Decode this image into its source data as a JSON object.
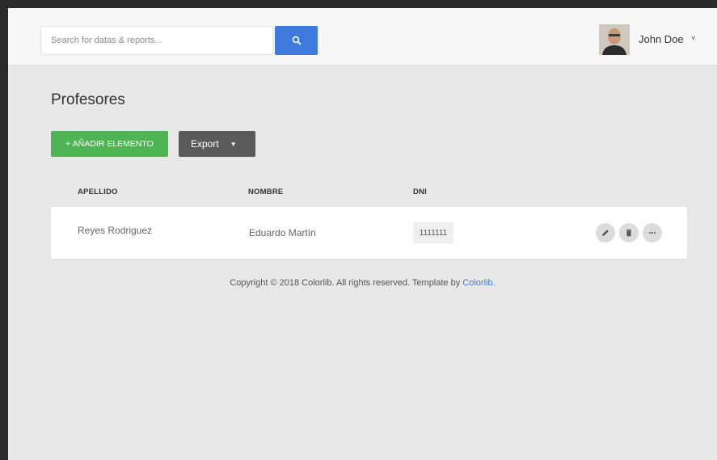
{
  "header": {
    "search_placeholder": "Search for datas & reports...",
    "user_name": "John Doe",
    "user_chevron": "˅"
  },
  "page": {
    "title": "Profesores",
    "add_button_label": "+ AÑADIR ELEMENTO",
    "export_button_label": "Export",
    "export_caret": "▼"
  },
  "table": {
    "columns": [
      "APELLIDO",
      "NOMBRE",
      "DNI"
    ],
    "rows": [
      {
        "apellido": "Reyes Rodriguez",
        "nombre": "Eduardo Martín",
        "dni": "1111111"
      }
    ]
  },
  "footer": {
    "text": "Copyright © 2018 Colorlib. All rights reserved. Template by",
    "link_text": "Colorlib."
  },
  "colors": {
    "accent_blue": "#3f7bdc",
    "add_green": "#4db554",
    "export_gray": "#5a5a5a",
    "background": "#e8e8e8"
  },
  "icons": {
    "search": "search-icon",
    "edit": "pencil-icon",
    "delete": "trash-icon",
    "more": "ellipsis-icon"
  }
}
